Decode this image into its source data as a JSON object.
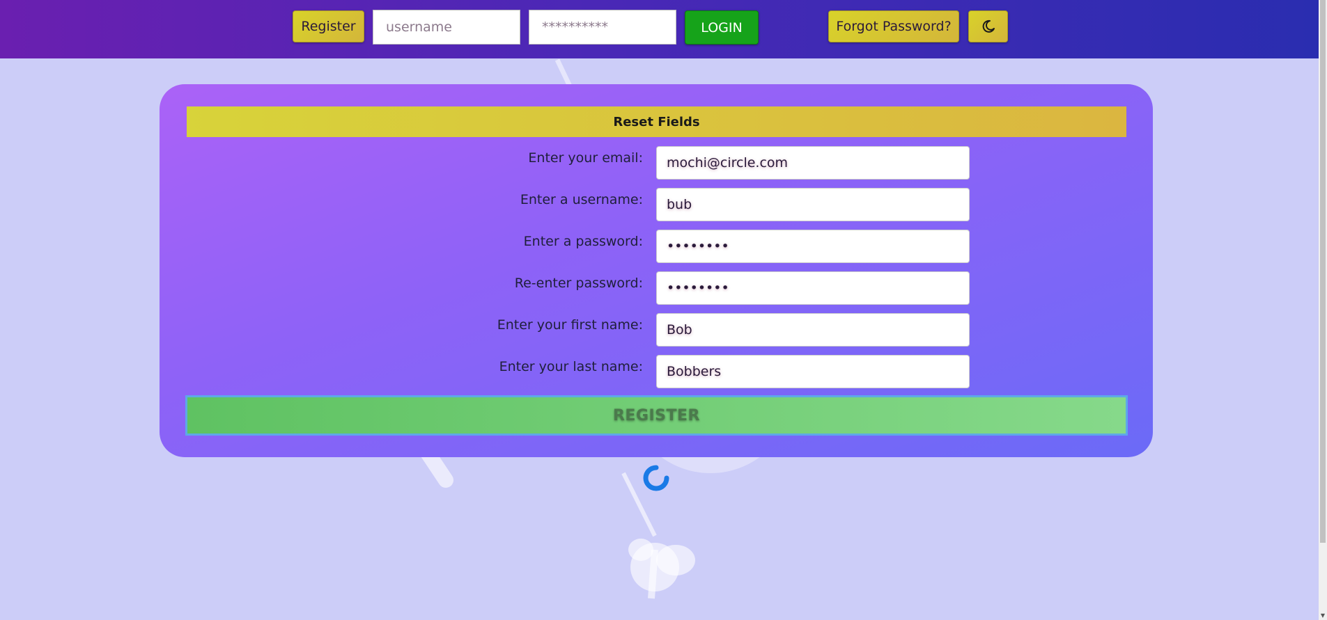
{
  "header": {
    "register_label": "Register",
    "username_placeholder": "username",
    "password_placeholder": "**********",
    "login_label": "LOGIN",
    "forgot_label": "Forgot Password?",
    "theme_icon": "moon-icon"
  },
  "form": {
    "reset_label": "Reset Fields",
    "fields": [
      {
        "label": "Enter your email:",
        "value": "mochi@circle.com"
      },
      {
        "label": "Enter a username:",
        "value": "bub"
      },
      {
        "label": "Enter a password:",
        "value": "••••••••"
      },
      {
        "label": "Re-enter password:",
        "value": "••••••••"
      },
      {
        "label": "Enter your first name:",
        "value": "Bob"
      },
      {
        "label": "Enter your last name:",
        "value": "Bobbers"
      }
    ],
    "submit_label": "REGISTER"
  },
  "colors": {
    "page_bg": "#cccdf8",
    "accent_yellow": "#d8d22a",
    "login_green": "#16a31a",
    "register_green": "#6fcb73",
    "spinner_blue": "#1a7ae6"
  }
}
